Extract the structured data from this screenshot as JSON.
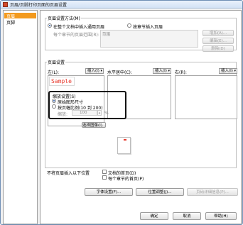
{
  "window": {
    "title": "页眉/页脚打印页面的页眉设置"
  },
  "nav": {
    "items": [
      "页眉",
      "页脚"
    ]
  },
  "section1": {
    "title": "页眉设置方法(M)",
    "radio_all": "在整个文档中插入通用页眉",
    "radio_each": "按章节插入页眉",
    "range_label": "每个章节的页眉范围(R):",
    "range_placeholder": "范围",
    "add_btn": "增加(A)...",
    "edit_btn": "编辑(E)...",
    "delete_btn": "删除(D)"
  },
  "section2": {
    "title": "页眉设置",
    "left_label": "左(L):",
    "center_label": "水平居中(C):",
    "right_label": "右(R):",
    "insert_btn": "插入(I)",
    "sample_text": "Sample"
  },
  "scale": {
    "title": "缩放设置(S)",
    "radio_original": "原始图形尺寸",
    "radio_width": "按页幅比例(10 到 200)",
    "scale_label": "缩放:",
    "scale_value": "100",
    "unit": "%",
    "select_image_btn": "选择图像(I)..."
  },
  "no_header": {
    "title": "不将页眉插入以下位置",
    "cover": "文档的首页(D)",
    "chapter": "每个章节的首页(P)"
  },
  "bottom_buttons": {
    "font": "字体设置(F)...",
    "position": "位置调整(J)...",
    "common": "页码详细信息(P)..."
  },
  "dialog_buttons": {
    "ok": "确定",
    "cancel": "取消",
    "help": "帮助(H)"
  },
  "colors": {
    "accent": "#f39a1e",
    "sample": "#e83a2e",
    "title_bg": "#d3e2f5"
  }
}
